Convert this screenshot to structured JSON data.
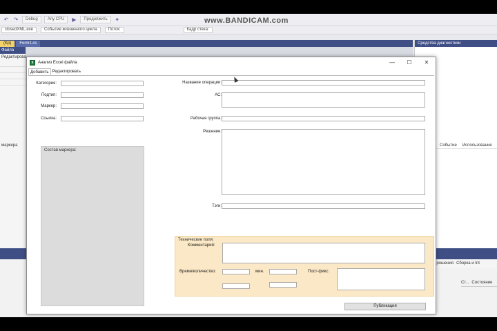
{
  "vs": {
    "toolbar": {
      "debug": "Debug",
      "cpu": "Any CPU",
      "continue": "Продолжить",
      "watermark": "www.BANDICAM.com"
    },
    "tabrow": {
      "process": "closedXML.exe",
      "event": "Событие жизненного цикла",
      "thread": "Поток:",
      "stack": "Кадр стека:"
    },
    "doc_tabs": [
      "(Kp)",
      "Form1.cs"
    ],
    "left_panel": {
      "header": "Файла",
      "tab": "Редактировать",
      "label": "маркера"
    },
    "right_panel": {
      "header": "Средства диагностики",
      "cols": [
        "Событие",
        "Использование"
      ]
    },
    "bottom": {
      "tabs": [
        "Прошения",
        "Сборка и Int"
      ],
      "cols": [
        "Ст...",
        "Состояние"
      ]
    }
  },
  "dialog": {
    "title": "Анализ Excel файла",
    "controls": {
      "minimize": "—",
      "maximize": "☐",
      "close": "✕"
    },
    "tabs": [
      {
        "label": "Добавить",
        "active": true
      },
      {
        "label": "Редактировать",
        "active": false
      }
    ],
    "left_fields": [
      {
        "label": "Категория:",
        "value": ""
      },
      {
        "label": "Подтип:",
        "value": ""
      },
      {
        "label": "Маркер:",
        "value": ""
      },
      {
        "label": "Ссылка:",
        "value": ""
      }
    ],
    "marker_box_title": "Состав маркера:",
    "right_fields": {
      "operation": "Название операции:",
      "as": "АС:",
      "workgroup": "Рабочая группа:",
      "solution": "Решение:",
      "tags": "Тэги:"
    },
    "tech": {
      "title": "Технические поля:",
      "comment": "Комментарий:",
      "time_qty": "Время/количество:",
      "min": "мин.",
      "postfix": "Пост-фикс:"
    },
    "publish": "Публикация"
  }
}
